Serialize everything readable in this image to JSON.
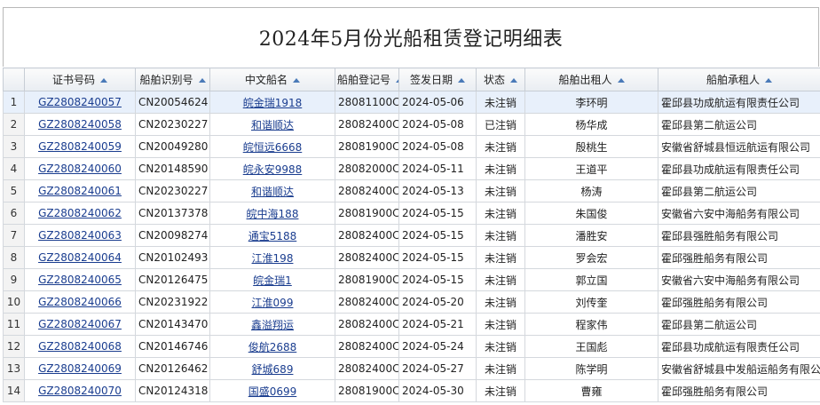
{
  "title": "2024年5月份光船租赁登记明细表",
  "columns": [
    {
      "label": "",
      "sortable": false
    },
    {
      "label": "证书号码",
      "sortable": true
    },
    {
      "label": "船舶识别号",
      "sortable": true
    },
    {
      "label": "中文船名",
      "sortable": true
    },
    {
      "label": "船舶登记号",
      "sortable": true
    },
    {
      "label": "签发日期",
      "sortable": true
    },
    {
      "label": "状态",
      "sortable": true
    },
    {
      "label": "船舶出租人",
      "sortable": true
    },
    {
      "label": "船舶承租人",
      "sortable": true
    }
  ],
  "rows": [
    {
      "n": "1",
      "cert": "GZ2808240057",
      "ident": "CN20054624",
      "name": "皖金瑞1918",
      "reg": "28081100C",
      "date": "2024-05-06",
      "status": "未注销",
      "lessor": "李环明",
      "lessee": "霍邱县功成航运有限责任公司"
    },
    {
      "n": "2",
      "cert": "GZ2808240058",
      "ident": "CN20230227",
      "name": "和谐顺达",
      "reg": "28082400C",
      "date": "2024-05-08",
      "status": "已注销",
      "lessor": "杨华成",
      "lessee": "霍邱县第二航运公司"
    },
    {
      "n": "3",
      "cert": "GZ2808240059",
      "ident": "CN20049280",
      "name": "皖恒远6668",
      "reg": "28081900C",
      "date": "2024-05-08",
      "status": "未注销",
      "lessor": "殷桃生",
      "lessee": "安徽省舒城县恒远航运有限公司"
    },
    {
      "n": "4",
      "cert": "GZ2808240060",
      "ident": "CN20148590",
      "name": "皖永安9988",
      "reg": "28082000C",
      "date": "2024-05-11",
      "status": "未注销",
      "lessor": "王道平",
      "lessee": "霍邱县功成航运有限责任公司"
    },
    {
      "n": "5",
      "cert": "GZ2808240061",
      "ident": "CN20230227",
      "name": "和谐顺达",
      "reg": "28082400C",
      "date": "2024-05-13",
      "status": "未注销",
      "lessor": "杨涛",
      "lessee": "霍邱县第二航运公司"
    },
    {
      "n": "6",
      "cert": "GZ2808240062",
      "ident": "CN20137378",
      "name": "皖中海188",
      "reg": "28081900C",
      "date": "2024-05-15",
      "status": "未注销",
      "lessor": "朱国俊",
      "lessee": "安徽省六安中海船务有限公司"
    },
    {
      "n": "7",
      "cert": "GZ2808240063",
      "ident": "CN20098274",
      "name": "通宝5188",
      "reg": "28082400C",
      "date": "2024-05-15",
      "status": "未注销",
      "lessor": "潘胜安",
      "lessee": "霍邱县强胜船务有限公司"
    },
    {
      "n": "8",
      "cert": "GZ2808240064",
      "ident": "CN20102493",
      "name": "江淮198",
      "reg": "28082400C",
      "date": "2024-05-15",
      "status": "未注销",
      "lessor": "罗会宏",
      "lessee": "霍邱强胜船务有限公司"
    },
    {
      "n": "9",
      "cert": "GZ2808240065",
      "ident": "CN20126475",
      "name": "皖金瑞1",
      "reg": "28081900C",
      "date": "2024-05-15",
      "status": "未注销",
      "lessor": "郭立国",
      "lessee": "安徽省六安中海船务有限公司"
    },
    {
      "n": "10",
      "cert": "GZ2808240066",
      "ident": "CN20231922",
      "name": "江淮099",
      "reg": "28082400C",
      "date": "2024-05-20",
      "status": "未注销",
      "lessor": "刘传奎",
      "lessee": "霍邱强胜船务有限公司"
    },
    {
      "n": "11",
      "cert": "GZ2808240067",
      "ident": "CN20143470",
      "name": "鑫溢翔运",
      "reg": "28082400C",
      "date": "2024-05-21",
      "status": "未注销",
      "lessor": "程家伟",
      "lessee": "霍邱县第二航运公司"
    },
    {
      "n": "12",
      "cert": "GZ2808240068",
      "ident": "CN20146746",
      "name": "俊航2688",
      "reg": "28082400C",
      "date": "2024-05-24",
      "status": "未注销",
      "lessor": "王国彪",
      "lessee": "霍邱县功成航运有限责任公司"
    },
    {
      "n": "13",
      "cert": "GZ2808240069",
      "ident": "CN20126462",
      "name": "舒城689",
      "reg": "28082400C",
      "date": "2024-05-27",
      "status": "未注销",
      "lessor": "陈学明",
      "lessee": "安徽省舒城县中发船运船务有限公"
    },
    {
      "n": "14",
      "cert": "GZ2808240070",
      "ident": "CN20124318",
      "name": "国盛0699",
      "reg": "28081900C",
      "date": "2024-05-30",
      "status": "未注销",
      "lessor": "曹雍",
      "lessee": "霍邱强胜船务有限公司"
    }
  ],
  "colors": {
    "link": "#1a3d8f",
    "selected_row": "#e8f0fb",
    "sort_arrow": "#4a7ab8"
  }
}
